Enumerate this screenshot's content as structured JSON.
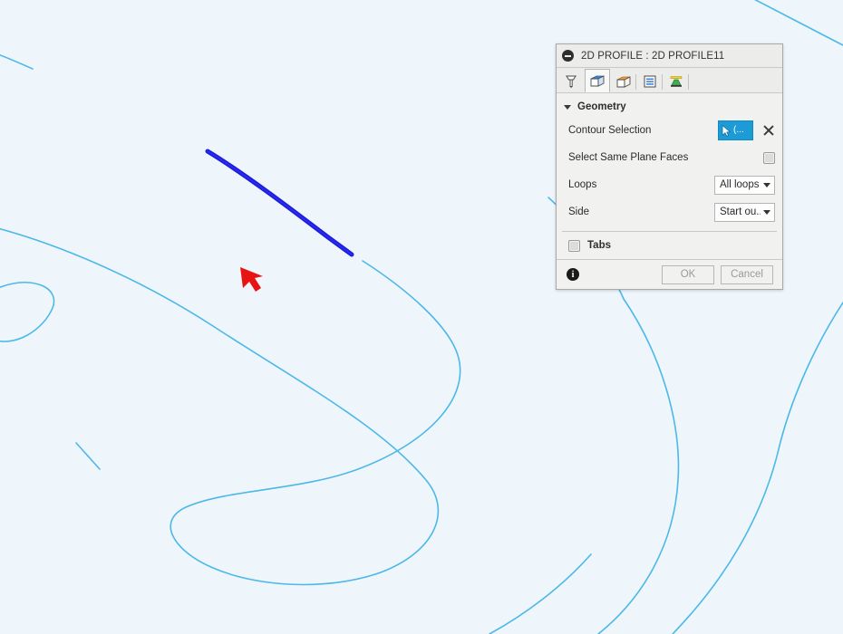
{
  "app": {
    "background_color": "#eef6fc",
    "sketch_line_color": "#4cb8e8",
    "selected_line_color": "#1a1ae0",
    "cursor_color": "#e81414"
  },
  "canvas": {
    "cursor_name": "red-arrow-cursor",
    "selected_edge_name": "selected-contour-edge",
    "sketch_curve_names": [
      "sketch-curve-top-left",
      "sketch-curve-main-loop",
      "sketch-curve-hook",
      "sketch-curve-right-arc",
      "sketch-curve-outer-arc",
      "sketch-curve-top-right"
    ]
  },
  "dialog": {
    "title": "2D PROFILE : 2D PROFILE11",
    "collapse_icon": "collapse-minus-icon",
    "tabs": [
      {
        "name": "tool-tab",
        "icon": "endmill-tool-icon",
        "active": false,
        "separator_after": false
      },
      {
        "name": "geometry-tab",
        "icon": "blue-cube-icon",
        "active": true,
        "separator_after": false
      },
      {
        "name": "heights-tab",
        "icon": "orange-cube-icon",
        "active": false,
        "separator_after": true
      },
      {
        "name": "passes-tab",
        "icon": "passes-stripes-icon",
        "active": false,
        "separator_after": true
      },
      {
        "name": "linking-tab",
        "icon": "linking-ramp-icon",
        "active": false,
        "separator_after": true
      }
    ],
    "geometry": {
      "header": "Geometry",
      "contour_selection": {
        "label": "Contour Selection",
        "button_text": "(...",
        "button_icon": "mouse-pointer-icon",
        "button_color": "#1d9bd6",
        "clear_icon": "clear-x-icon"
      },
      "select_same_plane_faces": {
        "label": "Select Same Plane Faces",
        "checked": false
      },
      "loops": {
        "label": "Loops",
        "value": "All loops"
      },
      "side": {
        "label": "Side",
        "value": "Start ou..."
      }
    },
    "tabs_section": {
      "label": "Tabs",
      "checked": false
    },
    "footer": {
      "info_icon": "info-circle-icon",
      "info_glyph": "i",
      "ok_label": "OK",
      "cancel_label": "Cancel",
      "buttons_enabled": false
    }
  }
}
